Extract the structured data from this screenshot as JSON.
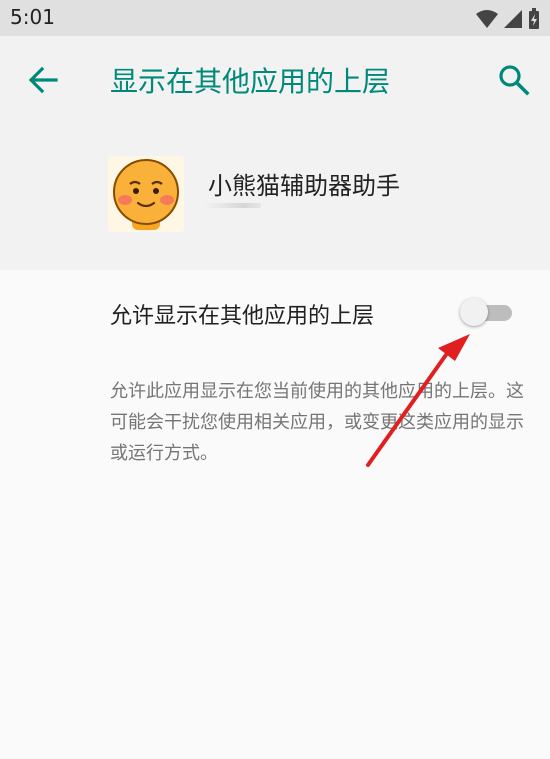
{
  "status_bar": {
    "time": "5:01",
    "icons": [
      "wifi-icon",
      "cellular-signal-icon",
      "battery-charging-icon"
    ]
  },
  "app_bar": {
    "title": "显示在其他应用的上层",
    "back_icon": "arrow-back-icon",
    "search_icon": "search-icon"
  },
  "app_info": {
    "name": "小熊猫辅助器助手",
    "icon": "smiley-face-icon"
  },
  "setting": {
    "label": "允许显示在其他应用的上层",
    "enabled": false
  },
  "description": "允许此应用显示在您当前使用的其他应用的上层。这可能会干扰您使用相关应用，或变更这类应用的显示或运行方式。",
  "colors": {
    "accent": "#00897b",
    "annotation_arrow": "#e02020",
    "status_bar_bg": "#e0e0e0",
    "header_bg": "#f2f2f2",
    "page_bg": "#fafafa"
  }
}
